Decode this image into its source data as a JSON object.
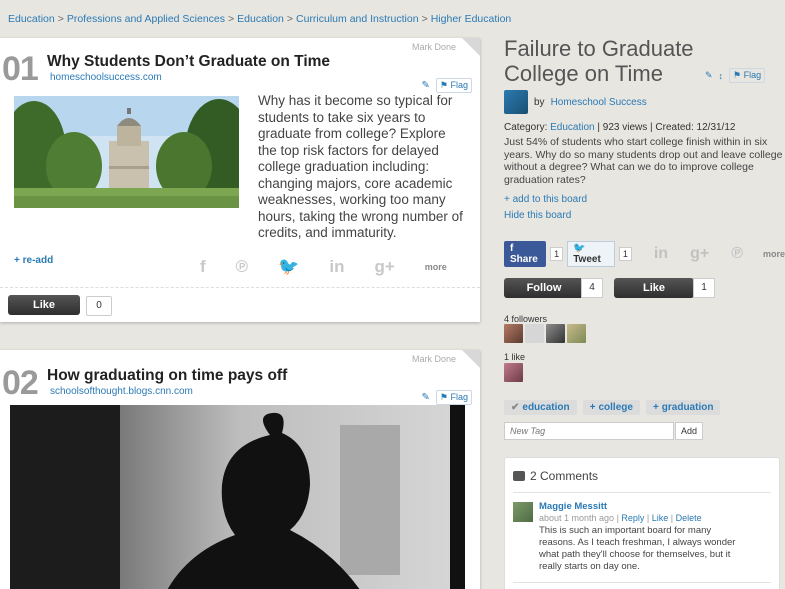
{
  "breadcrumb": [
    "Education",
    "Professions and Applied Sciences",
    "Education",
    "Curriculum and Instruction",
    "Higher Education"
  ],
  "cards": [
    {
      "number": "01",
      "title": "Why Students Don’t Graduate on Time",
      "source": "homeschoolsuccess.com",
      "mark_done": "Mark Done",
      "flag": "Flag",
      "description": "Why has it become so typical for students to take six years to graduate from college? Explore the top risk factors for delayed college graduation including: changing majors, core academic weaknesses, working too many hours, taking the wrong number of credits, and immaturity.",
      "readd": "+ re-add",
      "more": "more",
      "like_label": "Like",
      "like_count": "0"
    },
    {
      "number": "02",
      "title": "How graduating on time pays off",
      "source": "schoolsofthought.blogs.cnn.com",
      "mark_done": "Mark Done",
      "flag": "Flag"
    }
  ],
  "board": {
    "title": "Failure to Graduate College on Time",
    "flag": "Flag",
    "by_prefix": "by",
    "author": "Homeschool Success",
    "category_label": "Category:",
    "category": "Education",
    "stats": "| 923 views | Created: 12/31/12",
    "summary": "Just 54% of students who start college finish within in six years. Why do so many students drop out and leave college without a degree? What can we do to improve college graduation rates?",
    "add_board": "+ add to this board",
    "hide_board": "Hide this board",
    "share_label": "Share",
    "share_count": "1",
    "tweet_label": "Tweet",
    "tweet_count": "1",
    "more": "more",
    "follow_label": "Follow",
    "follow_count": "4",
    "like_label": "Like",
    "like_count": "1",
    "followers_label": "4 followers",
    "likes_label": "1 like",
    "tags": [
      "education",
      "college",
      "graduation"
    ],
    "new_tag_placeholder": "New Tag",
    "add_tag_label": "Add"
  },
  "comments": {
    "header": "2 Comments",
    "items": [
      {
        "author": "Maggie Messitt",
        "time": "about 1 month ago",
        "reply": "Reply",
        "like": "Like",
        "delete": "Delete",
        "text": "This is such an important board for many reasons. As I teach freshman, I always wonder what path they'll choose for themselves, but it really starts on day one."
      }
    ]
  },
  "colors": {
    "accent": "#2a7ab5",
    "facebook": "#3b5998",
    "background": "#e8e6e1"
  }
}
